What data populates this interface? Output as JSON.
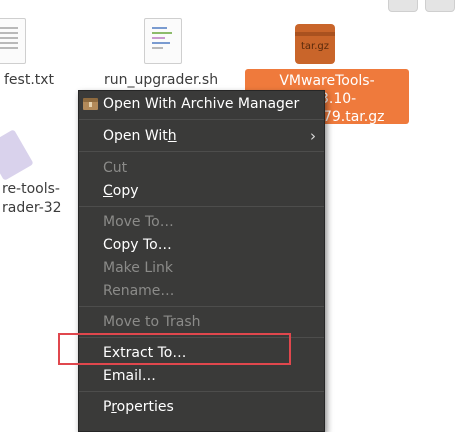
{
  "files": {
    "manifest_label": "fest.txt",
    "run_upgrader_label": "run_upgrader.sh",
    "vmware_archive_label": "VMwareTools-10.3.10-12301679.tar.gz",
    "vmware_archive_icon_text": "tar.gz",
    "vmware_tools_label_line1": "re-tools-",
    "vmware_tools_label_line2": "rader-32"
  },
  "context_menu": {
    "open_archive_manager": "Open With Archive Manager",
    "open_with_prefix": "Open Wit",
    "open_with_mnemonic": "h",
    "cut": "Cut",
    "copy_mnemonic": "C",
    "copy_rest": "opy",
    "move_to": "Move To…",
    "copy_to": "Copy To…",
    "make_link": "Make Link",
    "rename": "Rename…",
    "move_to_trash": "Move to Trash",
    "extract_to": "Extract To…",
    "email": "Email…",
    "properties_prefix": "P",
    "properties_mnemonic": "r",
    "properties_rest": "operties"
  },
  "colors": {
    "selection": "#ef7a3c",
    "menu_bg": "#3a3a39",
    "highlight_box": "#e0474d"
  }
}
